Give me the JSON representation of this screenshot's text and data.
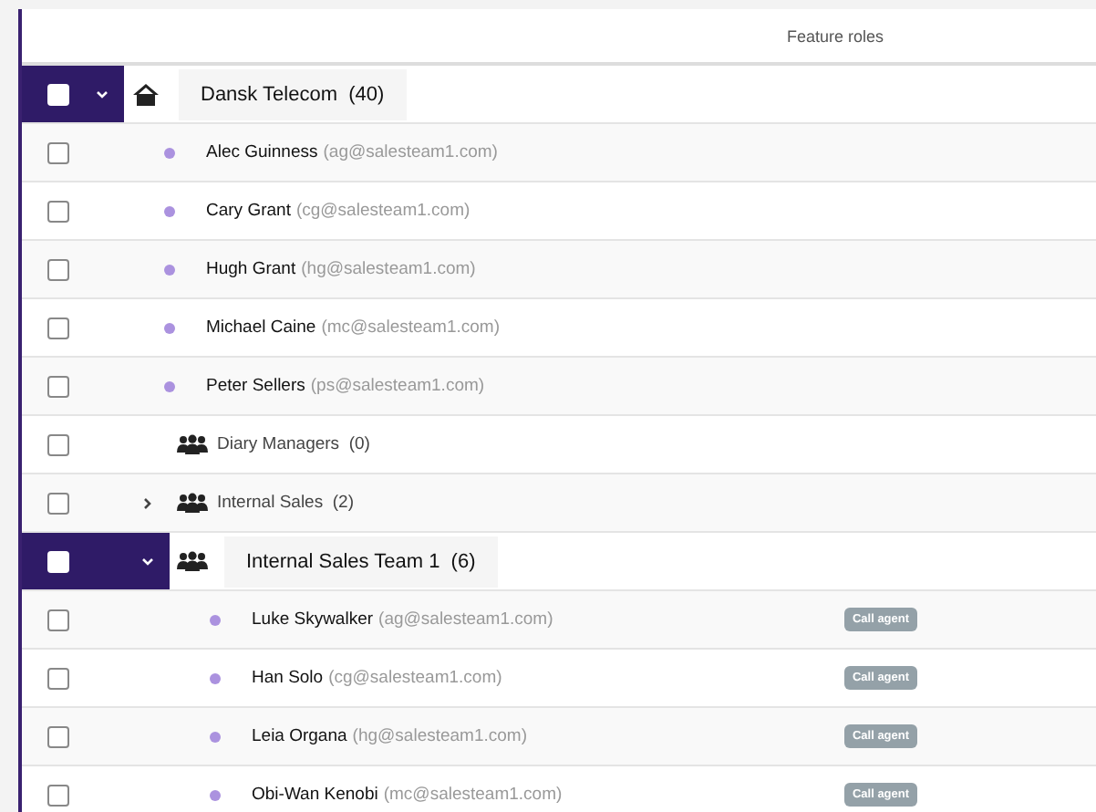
{
  "table": {
    "columns": [
      {},
      {
        "label": "Feature roles"
      }
    ],
    "tree": [
      {
        "kind": "group",
        "name": "Dansk Telecom",
        "count": "(40)",
        "checked": false,
        "expanded": true,
        "children": [
          {
            "kind": "member",
            "name": "Alec Guinness",
            "email": "(ag@salesteam1.com)",
            "checked": false
          },
          {
            "kind": "member",
            "name": "Cary Grant",
            "email": "(cg@salesteam1.com)",
            "checked": false
          },
          {
            "kind": "member",
            "name": "Hugh Grant",
            "email": "(hg@salesteam1.com)",
            "checked": false
          },
          {
            "kind": "member",
            "name": "Michael Caine",
            "email": "(mc@salesteam1.com)",
            "checked": false
          },
          {
            "kind": "member",
            "name": "Peter Sellers",
            "email": "(ps@salesteam1.com)",
            "checked": false
          },
          {
            "kind": "group",
            "name": "Diary Managers",
            "count": "(0)",
            "checked": false
          },
          {
            "kind": "group",
            "name": "Internal Sales",
            "count": "(2)",
            "checked": false,
            "expanded": false
          },
          {
            "kind": "group",
            "name": "Internal Sales Team 1",
            "count": "(6)",
            "checked": false,
            "expanded": true,
            "children": [
              {
                "kind": "member",
                "name": "Luke Skywalker",
                "email": "(ag@salesteam1.com)",
                "checked": false,
                "role": "Call agent"
              },
              {
                "kind": "member",
                "name": "Han Solo",
                "email": "(cg@salesteam1.com)",
                "checked": false,
                "role": "Call agent"
              },
              {
                "kind": "member",
                "name": "Leia Organa",
                "email": "(hg@salesteam1.com)",
                "checked": false,
                "role": "Call agent"
              },
              {
                "kind": "member",
                "name": "Obi-Wan Kenobi",
                "email": "(mc@salesteam1.com)",
                "checked": false,
                "role": "Call agent"
              }
            ]
          }
        ]
      }
    ]
  }
}
